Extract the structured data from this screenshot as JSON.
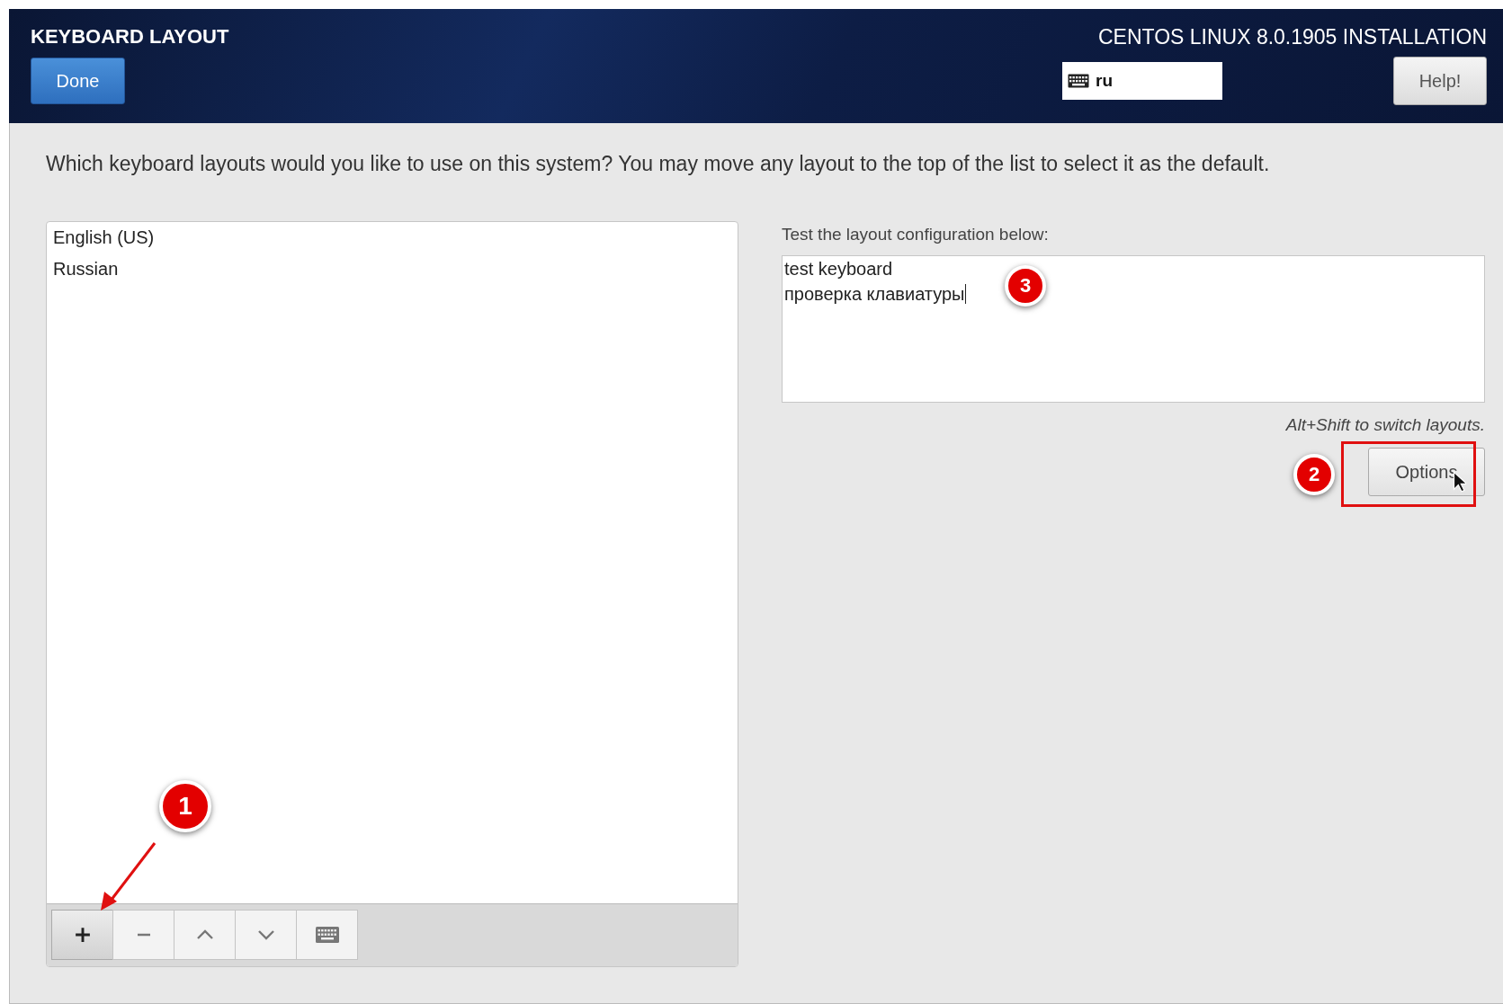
{
  "header": {
    "title": "KEYBOARD LAYOUT",
    "done_button": "Done",
    "product": "CENTOS LINUX 8.0.1905 INSTALLATION",
    "keyboard_indicator": "ru",
    "help_button": "Help!"
  },
  "instruction": "Which keyboard layouts would you like to use on this system?  You may move any layout to the top of the list to select it as the default.",
  "layouts": [
    {
      "name": "English (US)"
    },
    {
      "name": "Russian"
    }
  ],
  "layout_toolbar": [
    {
      "kind": "add",
      "selected": true
    },
    {
      "kind": "remove",
      "selected": false
    },
    {
      "kind": "up",
      "selected": false
    },
    {
      "kind": "down",
      "selected": false
    },
    {
      "kind": "preview",
      "selected": false
    }
  ],
  "test": {
    "label": "Test the layout configuration below:",
    "value": "test keyboard\nпроверка клавиатуры",
    "hint": "Alt+Shift to switch layouts.",
    "options_button": "Options"
  },
  "annotations": [
    {
      "number": "1"
    },
    {
      "number": "2"
    },
    {
      "number": "3"
    }
  ]
}
